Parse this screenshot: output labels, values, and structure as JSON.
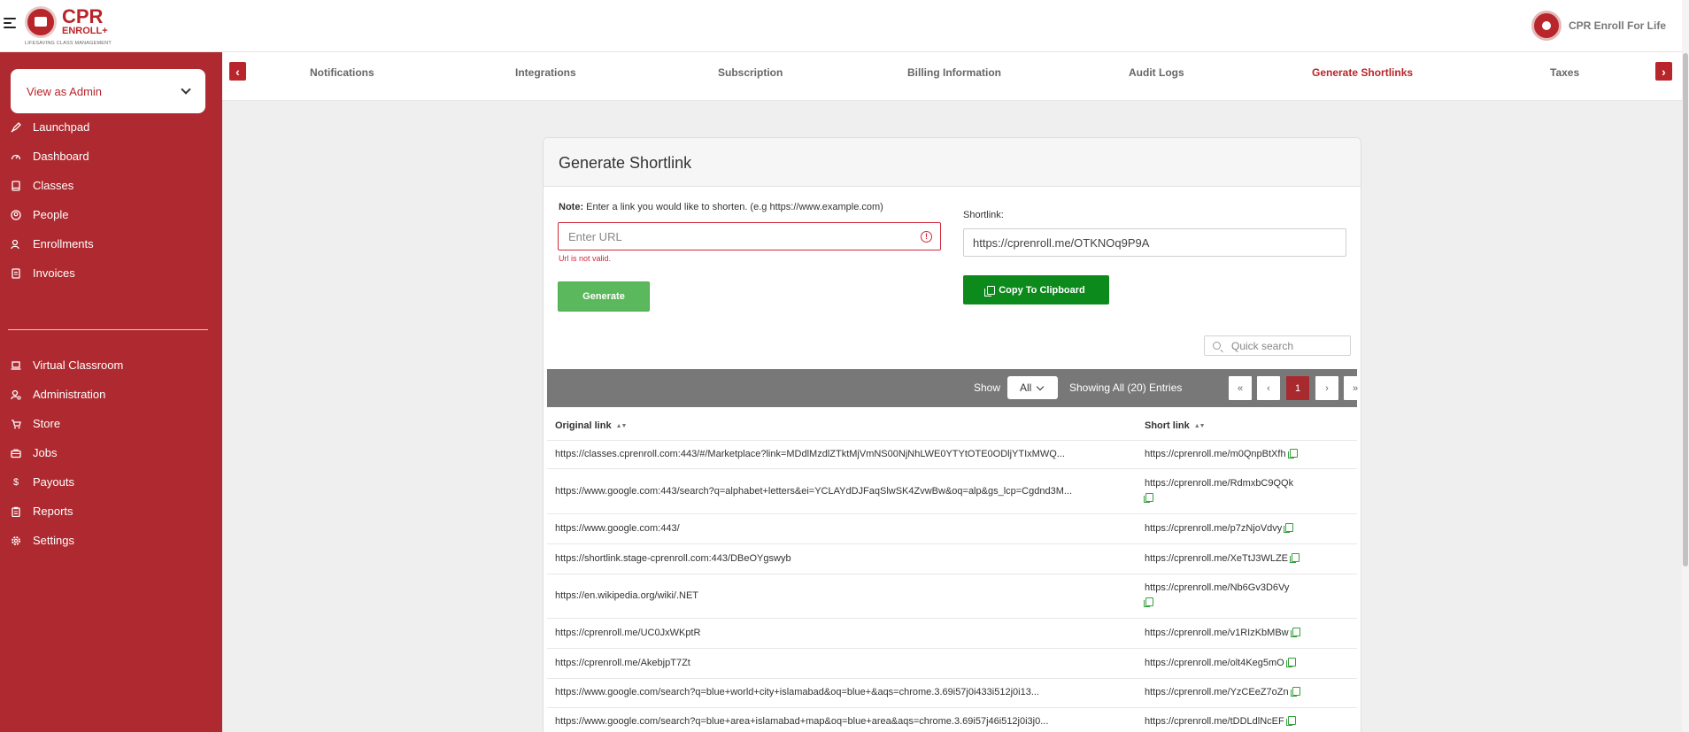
{
  "brand": {
    "logo_main": "CPR",
    "logo_sub": "ENROLL+",
    "logo_tagline": "LIFESAVING CLASS MANAGEMENT",
    "org_name": "CPR Enroll For Life"
  },
  "sidebar": {
    "view_select": "View as Admin",
    "primary": [
      {
        "label": "Launchpad",
        "icon": "rocket-icon"
      },
      {
        "label": "Dashboard",
        "icon": "gauge-icon"
      },
      {
        "label": "Classes",
        "icon": "book-icon"
      },
      {
        "label": "People",
        "icon": "person-icon"
      },
      {
        "label": "Enrollments",
        "icon": "enrollment-icon"
      },
      {
        "label": "Invoices",
        "icon": "invoice-icon"
      }
    ],
    "secondary": [
      {
        "label": "Virtual Classroom",
        "icon": "laptop-icon"
      },
      {
        "label": "Administration",
        "icon": "admin-icon"
      },
      {
        "label": "Store",
        "icon": "cart-icon"
      },
      {
        "label": "Jobs",
        "icon": "briefcase-icon"
      },
      {
        "label": "Payouts",
        "icon": "dollar-icon"
      },
      {
        "label": "Reports",
        "icon": "clipboard-icon"
      },
      {
        "label": "Settings",
        "icon": "gear-icon"
      }
    ]
  },
  "tabs": {
    "items": [
      "Notifications",
      "Integrations",
      "Subscription",
      "Billing Information",
      "Audit Logs",
      "Generate Shortlinks",
      "Taxes"
    ],
    "active": "Generate Shortlinks",
    "prev_arrow": "‹",
    "next_arrow": "›"
  },
  "card": {
    "title": "Generate Shortlink",
    "note_label": "Note:",
    "note_text": "Enter a link you would like to shorten. (e.g https://www.example.com)",
    "url_placeholder": "Enter URL",
    "url_value": "",
    "error_icon": "!",
    "error_text": "Url is not valid.",
    "generate_label": "Generate",
    "shortlink_label": "Shortlink:",
    "shortlink_value": "https://cprenroll.me/OTKNOq9P9A",
    "copy_label": "Copy To Clipboard",
    "search_placeholder": "Quick search"
  },
  "pager": {
    "show_label": "Show",
    "show_value": "All",
    "showing_text": "Showing All (20) Entries",
    "buttons": [
      "«",
      "‹",
      "1",
      "›",
      "»"
    ],
    "current_page": "1"
  },
  "table": {
    "columns": [
      "Original link",
      "Short link"
    ],
    "sort_glyph": "▲▼",
    "rows": [
      {
        "original": "https://classes.cprenroll.com:443/#/Marketplace?link=MDdlMzdlZTktMjVmNS00NjNhLWE0YTYtOTE0ODljYTIxMWQ...",
        "short": "https://cprenroll.me/m0QnpBtXfh"
      },
      {
        "original": "https://www.google.com:443/search?q=alphabet+letters&ei=YCLAYdDJFaqSlwSK4ZvwBw&oq=alp&gs_lcp=Cgdnd3M...",
        "short": "https://cprenroll.me/RdmxbC9QQk"
      },
      {
        "original": "https://www.google.com:443/",
        "short": "https://cprenroll.me/p7zNjoVdvy"
      },
      {
        "original": "https://shortlink.stage-cprenroll.com:443/DBeOYgswyb",
        "short": "https://cprenroll.me/XeTtJ3WLZE"
      },
      {
        "original": "https://en.wikipedia.org/wiki/.NET",
        "short": "https://cprenroll.me/Nb6Gv3D6Vy"
      },
      {
        "original": "https://cprenroll.me/UC0JxWKptR",
        "short": "https://cprenroll.me/v1RIzKbMBw"
      },
      {
        "original": "https://cprenroll.me/AkebjpT7Zt",
        "short": "https://cprenroll.me/olt4Keg5mO"
      },
      {
        "original": "https://www.google.com/search?q=blue+world+city+islamabad&oq=blue+&aqs=chrome.3.69i57j0i433i512j0i13...",
        "short": "https://cprenroll.me/YzCEeZ7oZn"
      },
      {
        "original": "https://www.google.com/search?q=blue+area+islamabad+map&oq=blue+area&aqs=chrome.3.69i57j46i512j0i3j0...",
        "short": "https://cprenroll.me/tDDLdlNcEF"
      }
    ]
  }
}
